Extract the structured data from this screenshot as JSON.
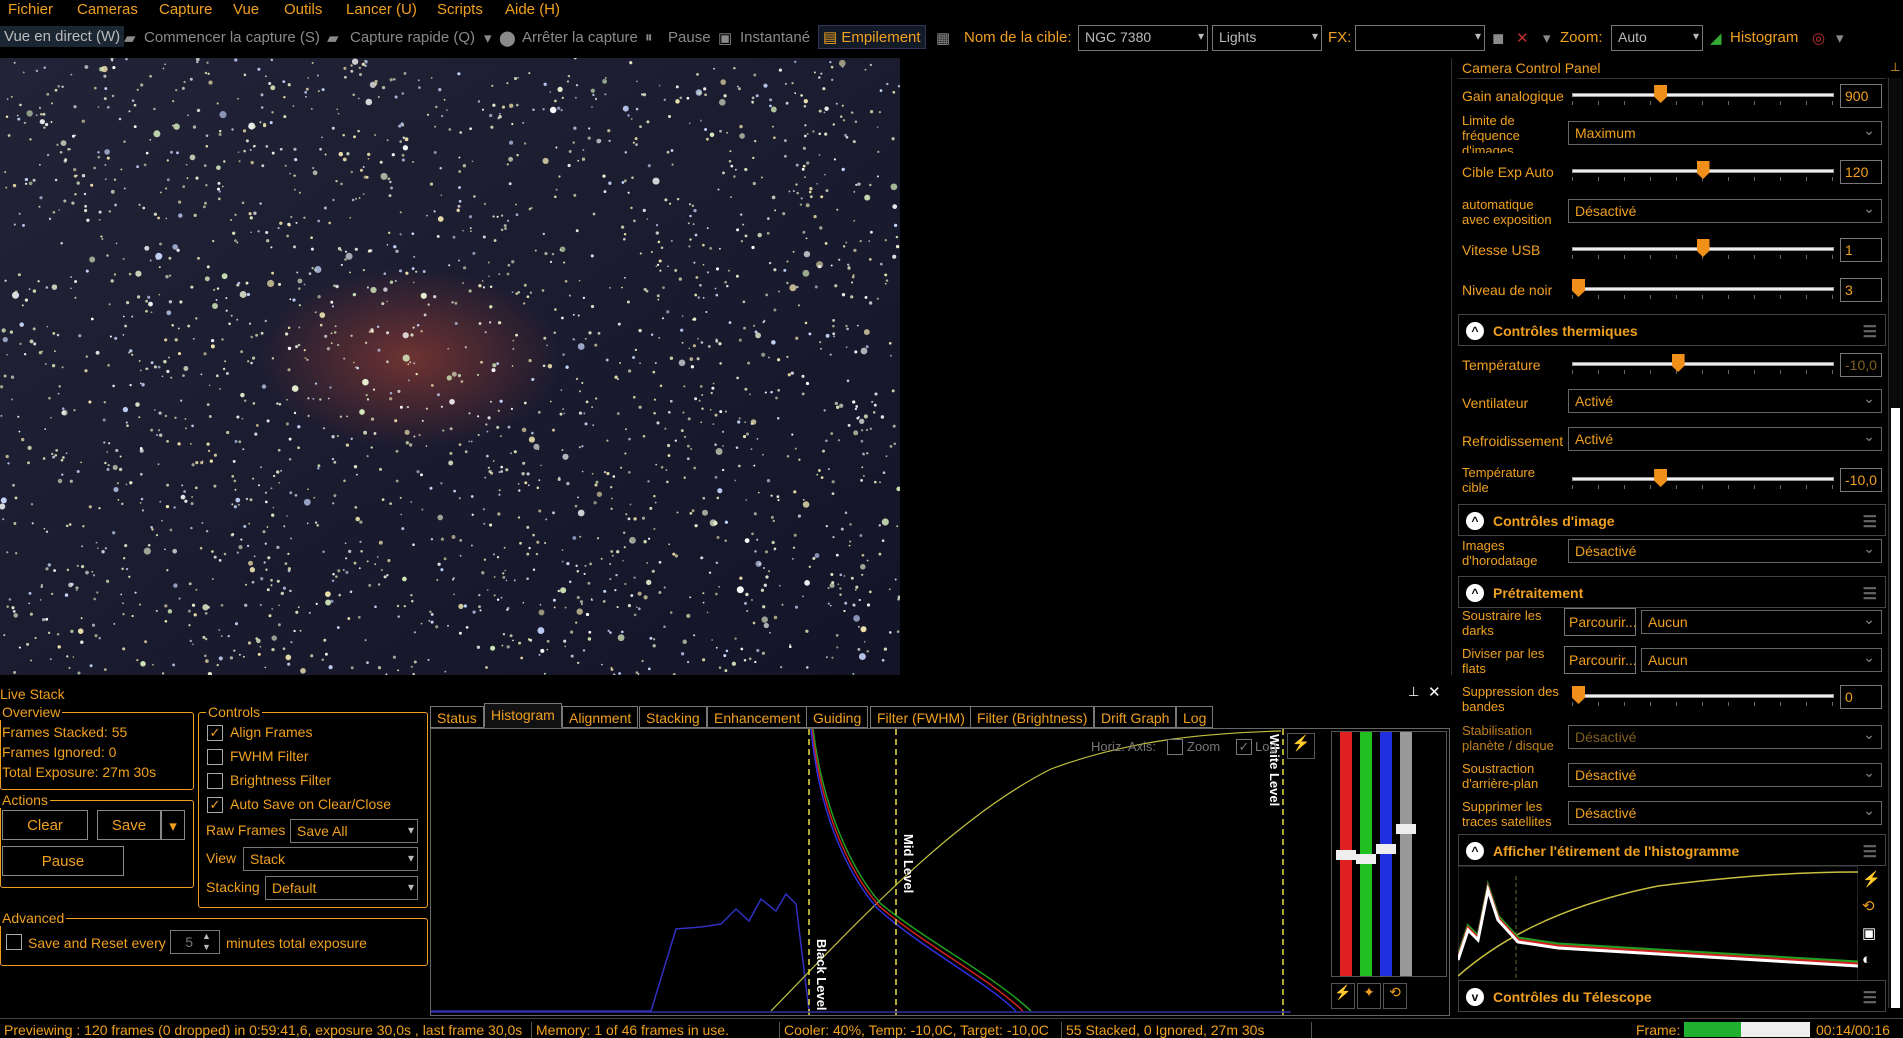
{
  "menu": [
    "Fichier",
    "Cameras",
    "Capture",
    "Vue",
    "Outils",
    "Lancer (U)",
    "Scripts",
    "Aide (H)"
  ],
  "toolbar": {
    "live_view": "Vue en direct (W)",
    "start_capture": "Commencer la capture (S)",
    "quick_capture": "Capture rapide (Q)",
    "stop_capture": "Arrêter la capture",
    "pause": "Pause",
    "snapshot": "Instantané",
    "stacking": "Empilement",
    "target_label": "Nom de la cible:",
    "target_value": "NGC 7380",
    "frame_type": "Lights",
    "fx_label": "FX:",
    "fx_value": "",
    "zoom_label": "Zoom:",
    "zoom_value": "Auto",
    "histogram": "Histogram"
  },
  "panel": {
    "title": "Camera Control Panel",
    "gain_label": "Gain analogique",
    "gain_value": "900",
    "gain_pos": 0.33,
    "framerate_label": "Limite de fréquence d'images",
    "framerate_value": "Maximum",
    "autoexp_label": "Cible Exp Auto",
    "autoexp_value": "120",
    "autoexp_pos": 0.5,
    "autoexposure_label": "automatique avec exposition",
    "autoexposure_value": "Désactivé",
    "usb_label": "Vitesse USB",
    "usb_value": "1",
    "usb_pos": 0.5,
    "black_label": "Niveau de noir",
    "black_value": "3",
    "black_pos": 0.0,
    "thermal_section": "Contrôles thermiques",
    "temp_label": "Température",
    "temp_value": "-10,0",
    "temp_pos": 0.4,
    "fan_label": "Ventilateur",
    "fan_value": "Activé",
    "cooling_label": "Refroidissement",
    "cooling_value": "Activé",
    "target_temp_label": "Température cible",
    "target_temp_value": "-10,0",
    "target_temp_pos": 0.33,
    "image_section": "Contrôles d'image",
    "timestamp_label": "Images d'horodatage",
    "timestamp_value": "Désactivé",
    "preproc_section": "Prétraitement",
    "darks_label": "Soustraire les darks",
    "darks_browse": "Parcourir...",
    "darks_value": "Aucun",
    "flats_label": "Diviser par les flats",
    "flats_browse": "Parcourir...",
    "flats_value": "Aucun",
    "banding_label": "Suppression des bandes",
    "banding_value": "0",
    "banding_pos": 0.0,
    "stabil_label": "Stabilisation planète / disque",
    "stabil_value": "Désactivé",
    "bgsub_label": "Soustraction d'arrière-plan",
    "bgsub_value": "Désactivé",
    "sat_label": "Supprimer les traces satellites",
    "sat_value": "Désactivé",
    "stretch_section": "Afficher l'étirement de l'histogramme",
    "telescope_section": "Contrôles du Télescope"
  },
  "live": {
    "title": "Live Stack",
    "overview_title": "Overview",
    "frames_stacked": "Frames Stacked: 55",
    "frames_ignored": "Frames Ignored:  0",
    "total_exposure": "Total Exposure:  27m 30s",
    "actions_title": "Actions",
    "clear": "Clear",
    "save": "Save",
    "pause": "Pause",
    "controls_title": "Controls",
    "align": "Align Frames",
    "align_checked": true,
    "fwhm": "FWHM Filter",
    "fwhm_checked": false,
    "brightness": "Brightness Filter",
    "brightness_checked": false,
    "autosave": "Auto Save on Clear/Close",
    "autosave_checked": true,
    "raw_label": "Raw Frames",
    "raw_value": "Save All",
    "view_label": "View",
    "view_value": "Stack",
    "stacking_label": "Stacking",
    "stacking_value": "Default",
    "advanced_title": "Advanced",
    "save_reset": "Save and Reset every",
    "save_reset_value": "5",
    "save_reset_suffix": "minutes total exposure",
    "tabs": [
      "Status",
      "Histogram",
      "Alignment",
      "Stacking",
      "Enhancement",
      "Guiding",
      "Filter (FWHM)",
      "Filter (Brightness)",
      "Drift Graph",
      "Log"
    ],
    "active_tab": 1,
    "horiz_axis": "Horiz. Axis:",
    "zoom_cb": "Zoom",
    "log_cb": "Log",
    "black_level": "Black Level",
    "mid_level": "Mid Level",
    "white_level": "White Level"
  },
  "status": {
    "preview": "Previewing : 120 frames (0 dropped) in 0:59:41,6, exposure 30,0s , last frame 30,0s",
    "memory": "Memory: 1 of 46 frames in use.",
    "cooler": "Cooler: 40%, Temp: -10,0C, Target: -10,0C",
    "stacked": "55 Stacked, 0 Ignored, 27m 30s",
    "frame_label": "Frame:",
    "frame_progress": 0.45,
    "time": "00:14/00:16"
  },
  "colors": {
    "accent": "#f0a020",
    "background": "#000000"
  }
}
